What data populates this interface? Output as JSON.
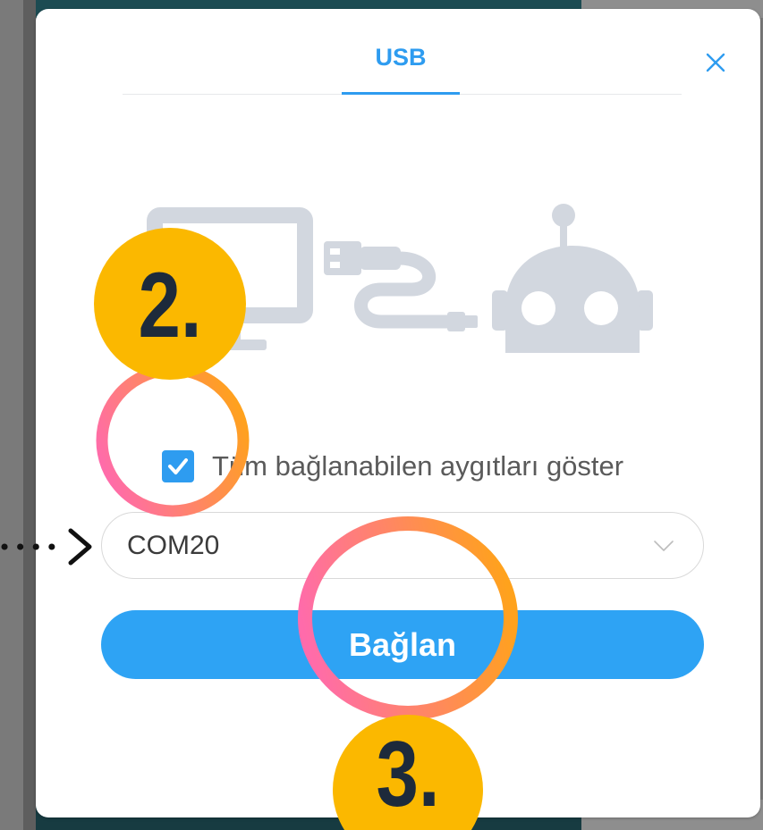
{
  "dialog": {
    "tabs": [
      {
        "label": "USB",
        "active": true
      }
    ],
    "close_icon": "close-icon",
    "illustration_icons": [
      "monitor-icon",
      "usb-cable-icon",
      "robot-icon"
    ],
    "show_all_devices": {
      "label": "Tüm bağlanabilen aygıtları göster",
      "checked": true,
      "icon": "checkmark-icon"
    },
    "port_select": {
      "value": "COM20",
      "icon": "chevron-down-icon"
    },
    "connect_button": {
      "label": "Bağlan"
    }
  },
  "annotations": {
    "step_badges": [
      {
        "label": "2."
      },
      {
        "label": "3."
      }
    ],
    "pointer_icon": "dotted-arrow-icon"
  },
  "colors": {
    "accent": "#2e9cf0",
    "button": "#2ea3f4",
    "illustration": "#d2d7df",
    "badge": "#fbb800",
    "badge_text": "#1d2a3b",
    "ring_start": "#ff6bab",
    "ring_end": "#ffa21c"
  }
}
